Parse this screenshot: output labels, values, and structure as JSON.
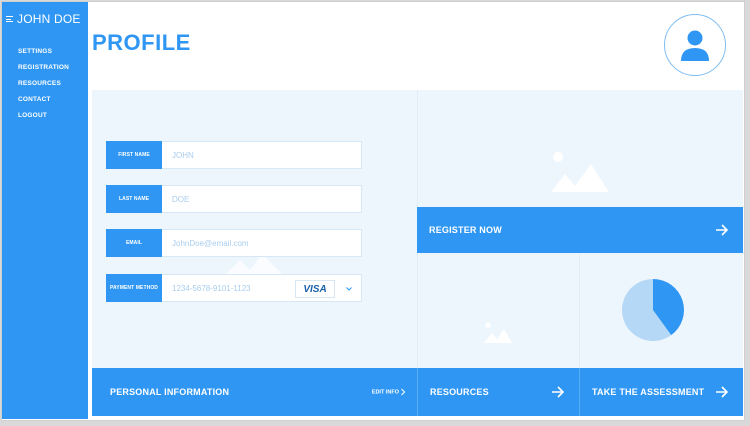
{
  "sidebar": {
    "user_name": "JOHN DOE",
    "items": [
      {
        "label": "SETTINGS"
      },
      {
        "label": "REGISTRATION"
      },
      {
        "label": "RESOURCES"
      },
      {
        "label": "CONTACT"
      },
      {
        "label": "LOGOUT"
      }
    ]
  },
  "header": {
    "title": "PROFILE"
  },
  "form": {
    "first_name": {
      "label": "FIRST NAME",
      "placeholder": "JOHN"
    },
    "last_name": {
      "label": "LAST NAME",
      "placeholder": "DOE"
    },
    "email": {
      "label": "EMAIL",
      "placeholder": "JohnDoe@email.com"
    },
    "payment": {
      "label": "PAYMENT METHOD",
      "placeholder": "1234-5678-9101-1123",
      "card_brand": "VISA"
    }
  },
  "tiles": {
    "register": "REGISTER NOW",
    "personal_info": "PERSONAL INFORMATION",
    "edit_info": "EDIT INFO",
    "resources": "RESOURCES",
    "assessment": "TAKE THE ASSESSMENT"
  },
  "chart_data": {
    "type": "pie",
    "values": [
      40,
      60
    ]
  },
  "icons": {
    "menu": "hamburger-icon",
    "avatar": "user-avatar-icon",
    "placeholder_image": "image-placeholder-icon",
    "arrow": "arrow-right-icon",
    "chevron": "chevron-right-icon",
    "dropdown": "chevron-down-icon"
  },
  "colors": {
    "accent": "#2f97f3",
    "panel_bg": "#edf5fd",
    "pie_light": "#b6d8f7",
    "pie_dark": "#2f97f3"
  }
}
